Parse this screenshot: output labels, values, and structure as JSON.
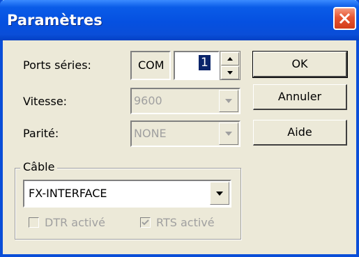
{
  "window": {
    "title": "Paramètres"
  },
  "ports": {
    "label": "Ports séries:",
    "prefix": "COM",
    "value": "1"
  },
  "speed": {
    "label": "Vitesse:",
    "value": "9600"
  },
  "parity": {
    "label": "Parité:",
    "value": "NONE"
  },
  "cable": {
    "group_title": "Câble",
    "value": "FX-INTERFACE",
    "dtr_label": "DTR activé",
    "dtr_checked": false,
    "rts_label": "RTS activé",
    "rts_checked": true
  },
  "buttons": {
    "ok": "OK",
    "cancel": "Annuler",
    "help": "Aide"
  },
  "colors": {
    "titlebar": "#0a4ed8",
    "close_button": "#e65532",
    "face": "#ece9d8",
    "disabled_text": "#a0a0a0"
  }
}
